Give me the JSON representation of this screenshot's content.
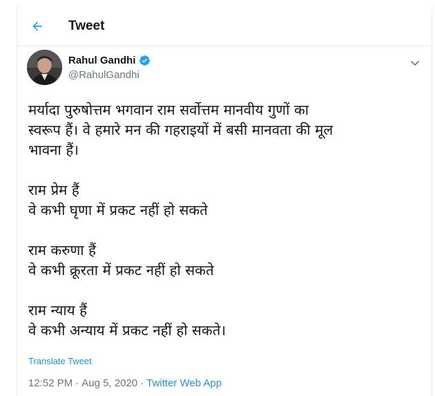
{
  "header": {
    "title": "Tweet"
  },
  "user": {
    "name": "Rahul Gandhi",
    "handle": "@RahulGandhi",
    "verified": true
  },
  "tweet": {
    "lines": [
      "मर्यादा पुरुषोत्तम भगवान राम सर्वोत्तम मानवीय गुणों का",
      "स्वरूप हैं। वे हमारे मन की गहराइयों में बसी मानवता की मूल",
      "भावना हैं।",
      "राम प्रेम हैं",
      "वे कभी घृणा में प्रकट नहीं हो सकते",
      "राम करुणा हैं",
      "वे कभी क्रूरता में प्रकट नहीं हो सकते",
      "राम न्याय हैं",
      "वे कभी अन्याय में प्रकट नहीं हो सकते।"
    ],
    "translate_label": "Translate Tweet",
    "time": "12:52 PM",
    "separator": "·",
    "date": "Aug 5, 2020",
    "source": "Twitter Web App"
  },
  "colors": {
    "accent": "#1da1f2",
    "link": "#1b95e0",
    "secondary_text": "#657786",
    "border": "#e6ecf0"
  },
  "icons": {
    "back": "arrow-left-icon",
    "verified": "verified-badge-icon",
    "menu": "chevron-down-icon"
  }
}
